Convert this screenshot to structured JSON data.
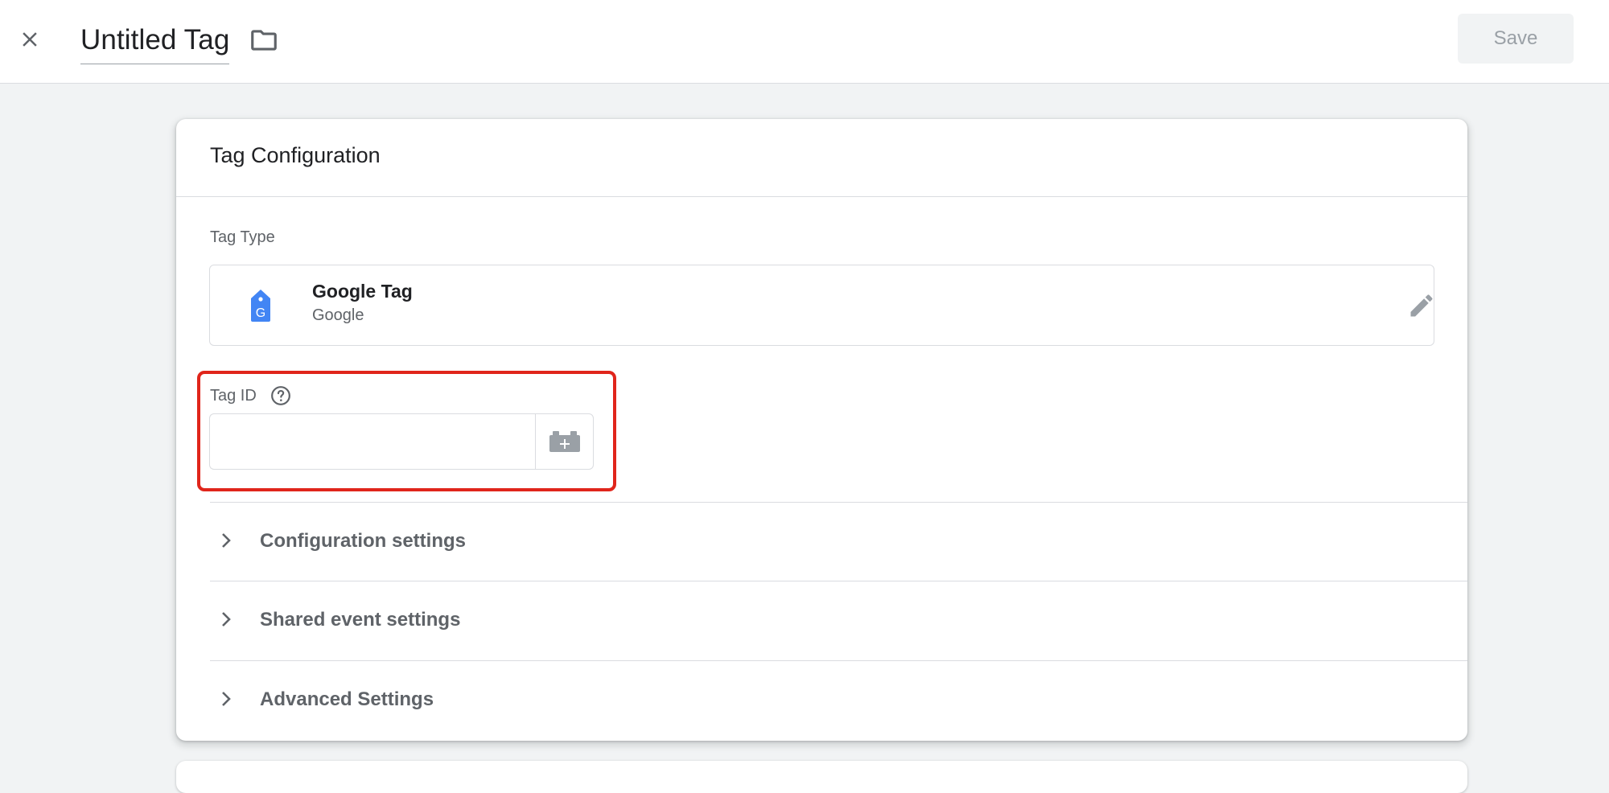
{
  "header": {
    "tag_name": "Untitled Tag",
    "save_label": "Save",
    "close_icon": "close-icon",
    "folder_icon": "folder-icon"
  },
  "card": {
    "title": "Tag Configuration",
    "tag_type_label": "Tag Type",
    "tag_type": {
      "name": "Google Tag",
      "vendor": "Google",
      "icon": "google-tag-icon",
      "icon_color": "#4285f4"
    },
    "tag_id": {
      "label": "Tag ID",
      "value": "",
      "placeholder": "",
      "help_icon": "help-icon",
      "variable_icon": "variable-picker-icon"
    },
    "sections": [
      {
        "label": "Configuration settings"
      },
      {
        "label": "Shared event settings"
      },
      {
        "label": "Advanced Settings"
      }
    ]
  },
  "colors": {
    "highlight": "#e0251b",
    "background": "#f1f3f4"
  }
}
